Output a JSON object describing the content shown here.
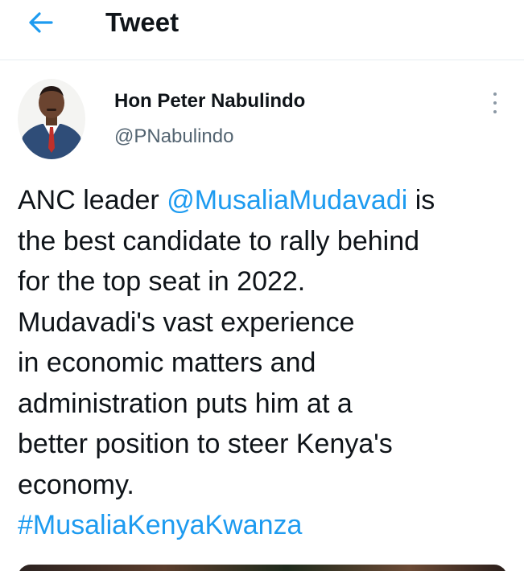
{
  "header": {
    "title": "Tweet",
    "back_icon": "arrow-left-icon"
  },
  "tweet": {
    "author": {
      "name": "Hon Peter Nabulindo",
      "handle": "@PNabulindo"
    },
    "more_icon": "more-vertical-icon",
    "text": {
      "l1_pre": "ANC leader ",
      "mention": "@MusaliaMudavadi",
      "l1_post": " is",
      "l2": "the best candidate to rally behind",
      "l3": "for the top seat in 2022.",
      "l4": "Mudavadi's vast experience",
      "l5": "in economic matters and",
      "l6": "administration puts him at a",
      "l7": "better position to steer Kenya's",
      "l8": "economy.",
      "hashtag": "#MusaliaKenyaKwanza"
    }
  },
  "colors": {
    "accent": "#1d9bf0",
    "text": "#0f1419",
    "secondary": "#536471"
  }
}
